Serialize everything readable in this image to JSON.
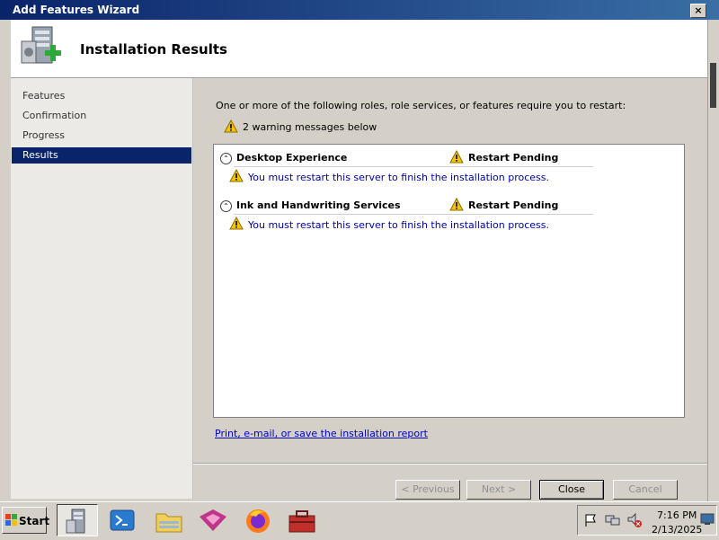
{
  "window": {
    "title": "Add Features Wizard",
    "close_glyph": "×"
  },
  "header": {
    "title": "Installation Results"
  },
  "nav": {
    "items": [
      {
        "label": "Features",
        "active": false
      },
      {
        "label": "Confirmation",
        "active": false
      },
      {
        "label": "Progress",
        "active": false
      },
      {
        "label": "Results",
        "active": true
      }
    ]
  },
  "main": {
    "intro": "One or more of the following roles, role services, or features require you to restart:",
    "warning_summary": "2 warning messages below",
    "results": [
      {
        "feature": "Desktop Experience",
        "status": "Restart Pending",
        "message": "You must restart this server to finish the installation process."
      },
      {
        "feature": "Ink and Handwriting Services",
        "status": "Restart Pending",
        "message": "You must restart this server to finish the installation process."
      }
    ],
    "report_link": "Print, e-mail, or save the installation report"
  },
  "buttons": {
    "previous": "< Previous",
    "next": "Next >",
    "close": "Close",
    "cancel": "Cancel"
  },
  "taskbar": {
    "start": "Start",
    "apps": [
      "server-manager-icon",
      "powershell-icon",
      "explorer-folder-icon",
      "visual-studio-icon",
      "firefox-icon",
      "toolbox-icon"
    ],
    "time": "7:16 PM",
    "date": "2/13/2025"
  },
  "colors": {
    "title_bar": "#0a246a",
    "nav_active": "#0a246a",
    "link": "#0000cc",
    "message": "#0000aa",
    "warning": "#f5c400"
  }
}
